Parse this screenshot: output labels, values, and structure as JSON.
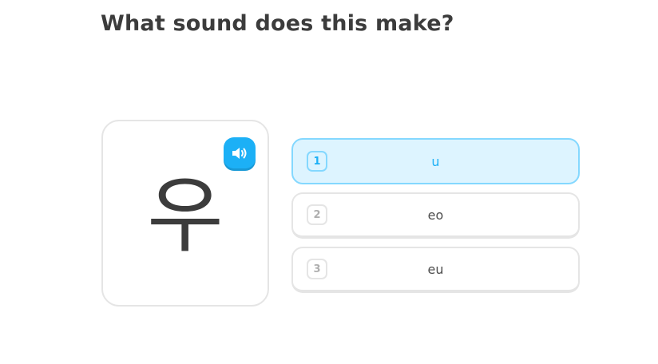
{
  "prompt": {
    "title": "What sound does this make?"
  },
  "character_card": {
    "character": "우",
    "audio_icon": "speaker-icon"
  },
  "options": [
    {
      "number": "1",
      "label": "u",
      "selected": true
    },
    {
      "number": "2",
      "label": "eo",
      "selected": false
    },
    {
      "number": "3",
      "label": "eu",
      "selected": false
    }
  ],
  "colors": {
    "accent": "#1cb0f6",
    "selected_bg": "#ddf4ff",
    "selected_border": "#84d8ff",
    "border": "#e5e5e5",
    "text": "#3c3c3c"
  }
}
